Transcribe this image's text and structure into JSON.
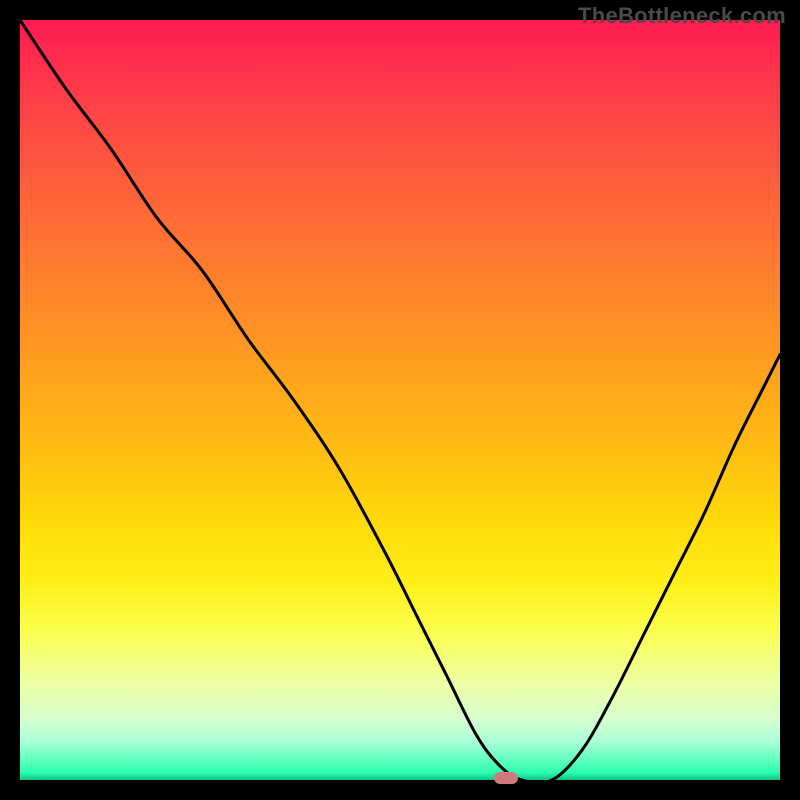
{
  "watermark": "TheBottleneck.com",
  "chart_data": {
    "type": "line",
    "title": "",
    "xlabel": "",
    "ylabel": "",
    "xlim": [
      0,
      100
    ],
    "ylim": [
      0,
      100
    ],
    "grid": false,
    "legend": false,
    "x": [
      0,
      6,
      12,
      18,
      24,
      30,
      36,
      42,
      48,
      52,
      56,
      60,
      63,
      66,
      70,
      74,
      78,
      82,
      86,
      90,
      94,
      98,
      100
    ],
    "values": [
      100,
      91,
      83,
      74,
      67,
      58,
      50,
      41,
      30,
      22,
      14,
      6,
      2,
      0,
      0,
      4,
      11,
      19,
      27,
      35,
      44,
      52,
      56
    ],
    "min_marker": {
      "x": 64,
      "y": 0
    },
    "curve_color": "#000000",
    "curve_width": 3
  }
}
